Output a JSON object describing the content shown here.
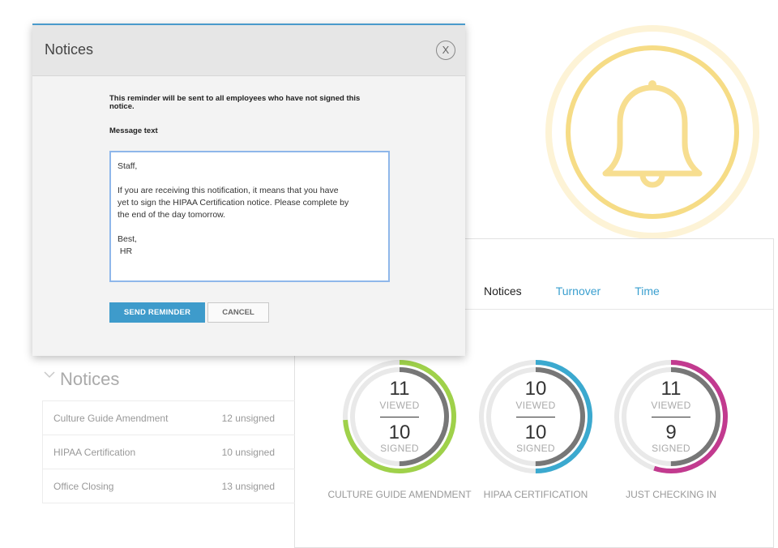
{
  "modal": {
    "title": "Notices",
    "close_label": "X",
    "info_text": "This reminder will be sent to all employees who have not signed this notice.",
    "message_label": "Message text",
    "message_value": "Staff,\n\nIf you are receiving this notification, it means that you have\nyet to sign the HIPAA Certification notice. Please complete by\nthe end of the day tomorrow.\n\nBest,\n HR",
    "send_label": "SEND REMINDER",
    "cancel_label": "CANCEL"
  },
  "dashboard": {
    "tabs": [
      {
        "label": "Notices",
        "active": true
      },
      {
        "label": "Turnover",
        "active": false
      },
      {
        "label": "Time",
        "active": false
      }
    ],
    "gauges": [
      {
        "viewed": "11",
        "viewed_label": "VIEWED",
        "signed": "10",
        "signed_label": "SIGNED",
        "caption": "CULTURE GUIDE AMENDMENT",
        "color": "#9fd14a",
        "color_fraction": 0.74,
        "gray_fraction": 0.5
      },
      {
        "viewed": "10",
        "viewed_label": "VIEWED",
        "signed": "10",
        "signed_label": "SIGNED",
        "caption": "HIPAA CERTIFICATION",
        "color": "#3ba9cf",
        "color_fraction": 0.5,
        "gray_fraction": 0.5
      },
      {
        "viewed": "11",
        "viewed_label": "VIEWED",
        "signed": "9",
        "signed_label": "SIGNED",
        "caption": "JUST CHECKING IN",
        "color": "#c23a8f",
        "color_fraction": 0.55,
        "gray_fraction": 0.5
      }
    ]
  },
  "notices": {
    "heading": "Notices",
    "items": [
      {
        "name": "Culture Guide Amendment",
        "status": "12 unsigned"
      },
      {
        "name": "HIPAA Certification",
        "status": "10 unsigned"
      },
      {
        "name": "Office Closing",
        "status": "13 unsigned"
      }
    ]
  },
  "colors": {
    "accent": "#3e9bcb",
    "bell": "#f5d77a"
  },
  "icons": [
    "bell-icon",
    "close-icon",
    "chevron-down-icon"
  ]
}
